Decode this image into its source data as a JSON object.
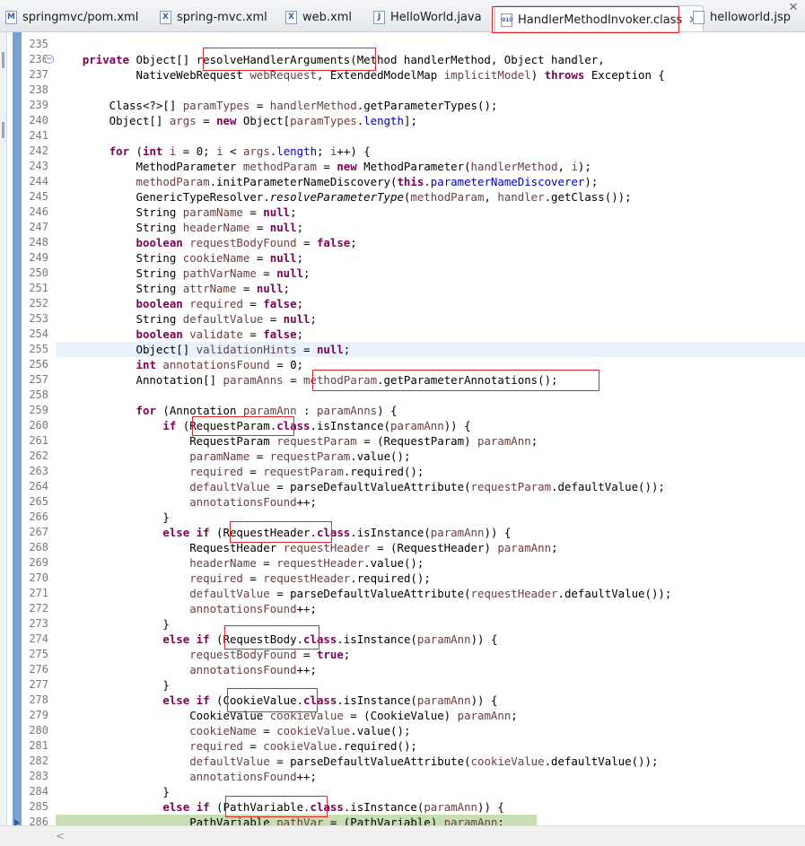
{
  "tabs": [
    {
      "label": "springmvc/pom.xml",
      "icon": "maven-file-icon",
      "glyph": "M",
      "active": false
    },
    {
      "label": "spring-mvc.xml",
      "icon": "xml-file-icon",
      "glyph": "X",
      "active": false
    },
    {
      "label": "web.xml",
      "icon": "xml-file-icon",
      "glyph": "X",
      "active": false
    },
    {
      "label": "HelloWorld.java",
      "icon": "java-file-icon",
      "glyph": "J",
      "active": false
    },
    {
      "label": "HandlerMethodInvoker.class",
      "icon": "class-file-icon",
      "glyph": "010",
      "active": true
    },
    {
      "label": "helloworld.jsp",
      "icon": "jsp-file-icon",
      "glyph": "",
      "active": false
    }
  ],
  "tab_close_glyph": "✕",
  "window_close_glyph": "✕",
  "lines": [
    {
      "n": "235",
      "t": []
    },
    {
      "n": "236",
      "t": [
        [
          "    ",
          ""
        ],
        [
          "private",
          "kw"
        ],
        [
          " Object[] resolveHandlerArguments(Method handlerMethod, Object handler,",
          ""
        ]
      ]
    },
    {
      "n": "237",
      "t": [
        [
          "            NativeWebRequest ",
          ""
        ],
        [
          "webRequest",
          "loc"
        ],
        [
          ", ExtendedModelMap ",
          ""
        ],
        [
          "implicitModel",
          "loc"
        ],
        [
          ") ",
          ""
        ],
        [
          "throws",
          "kw"
        ],
        [
          " Exception {",
          ""
        ]
      ]
    },
    {
      "n": "238",
      "t": []
    },
    {
      "n": "239",
      "t": [
        [
          "        Class<?>[] ",
          ""
        ],
        [
          "paramTypes",
          "loc"
        ],
        [
          " = ",
          ""
        ],
        [
          "handlerMethod",
          "loc"
        ],
        [
          ".getParameterTypes();",
          ""
        ]
      ]
    },
    {
      "n": "240",
      "t": [
        [
          "        Object[] ",
          ""
        ],
        [
          "args",
          "loc"
        ],
        [
          " = ",
          ""
        ],
        [
          "new",
          "kw"
        ],
        [
          " Object[",
          ""
        ],
        [
          "paramTypes",
          "loc"
        ],
        [
          ".",
          ""
        ],
        [
          "length",
          "fld"
        ],
        [
          "];",
          ""
        ]
      ]
    },
    {
      "n": "241",
      "t": []
    },
    {
      "n": "242",
      "t": [
        [
          "        ",
          ""
        ],
        [
          "for",
          "kw"
        ],
        [
          " (",
          ""
        ],
        [
          "int",
          "kw"
        ],
        [
          " ",
          ""
        ],
        [
          "i",
          "loc"
        ],
        [
          " = 0; ",
          ""
        ],
        [
          "i",
          "loc"
        ],
        [
          " < ",
          ""
        ],
        [
          "args",
          "loc"
        ],
        [
          ".",
          ""
        ],
        [
          "length",
          "fld"
        ],
        [
          "; ",
          ""
        ],
        [
          "i",
          "loc"
        ],
        [
          "++) {",
          ""
        ]
      ]
    },
    {
      "n": "243",
      "t": [
        [
          "            MethodParameter ",
          ""
        ],
        [
          "methodParam",
          "loc"
        ],
        [
          " = ",
          ""
        ],
        [
          "new",
          "kw"
        ],
        [
          " MethodParameter(",
          ""
        ],
        [
          "handlerMethod",
          "loc"
        ],
        [
          ", ",
          ""
        ],
        [
          "i",
          "loc"
        ],
        [
          ");",
          ""
        ]
      ]
    },
    {
      "n": "244",
      "t": [
        [
          "            ",
          ""
        ],
        [
          "methodParam",
          "loc"
        ],
        [
          ".initParameterNameDiscovery(",
          ""
        ],
        [
          "this",
          "kw"
        ],
        [
          ".",
          ""
        ],
        [
          "parameterNameDiscoverer",
          "fld"
        ],
        [
          ");",
          ""
        ]
      ]
    },
    {
      "n": "245",
      "t": [
        [
          "            GenericTypeResolver.",
          ""
        ],
        [
          "resolveParameterType",
          "ital"
        ],
        [
          "(",
          ""
        ],
        [
          "methodParam",
          "loc"
        ],
        [
          ", ",
          ""
        ],
        [
          "handler",
          "loc"
        ],
        [
          ".getClass());",
          ""
        ]
      ]
    },
    {
      "n": "246",
      "t": [
        [
          "            String ",
          ""
        ],
        [
          "paramName",
          "loc"
        ],
        [
          " = ",
          ""
        ],
        [
          "null",
          "kw"
        ],
        [
          ";",
          ""
        ]
      ]
    },
    {
      "n": "247",
      "t": [
        [
          "            String ",
          ""
        ],
        [
          "headerName",
          "loc"
        ],
        [
          " = ",
          ""
        ],
        [
          "null",
          "kw"
        ],
        [
          ";",
          ""
        ]
      ]
    },
    {
      "n": "248",
      "t": [
        [
          "            ",
          ""
        ],
        [
          "boolean",
          "kw"
        ],
        [
          " ",
          ""
        ],
        [
          "requestBodyFound",
          "loc"
        ],
        [
          " = ",
          ""
        ],
        [
          "false",
          "kw"
        ],
        [
          ";",
          ""
        ]
      ]
    },
    {
      "n": "249",
      "t": [
        [
          "            String ",
          ""
        ],
        [
          "cookieName",
          "loc"
        ],
        [
          " = ",
          ""
        ],
        [
          "null",
          "kw"
        ],
        [
          ";",
          ""
        ]
      ]
    },
    {
      "n": "250",
      "t": [
        [
          "            String ",
          ""
        ],
        [
          "pathVarName",
          "loc"
        ],
        [
          " = ",
          ""
        ],
        [
          "null",
          "kw"
        ],
        [
          ";",
          ""
        ]
      ]
    },
    {
      "n": "251",
      "t": [
        [
          "            String ",
          ""
        ],
        [
          "attrName",
          "loc"
        ],
        [
          " = ",
          ""
        ],
        [
          "null",
          "kw"
        ],
        [
          ";",
          ""
        ]
      ]
    },
    {
      "n": "252",
      "t": [
        [
          "            ",
          ""
        ],
        [
          "boolean",
          "kw"
        ],
        [
          " ",
          ""
        ],
        [
          "required",
          "loc"
        ],
        [
          " = ",
          ""
        ],
        [
          "false",
          "kw"
        ],
        [
          ";",
          ""
        ]
      ]
    },
    {
      "n": "253",
      "t": [
        [
          "            String ",
          ""
        ],
        [
          "defaultValue",
          "loc"
        ],
        [
          " = ",
          ""
        ],
        [
          "null",
          "kw"
        ],
        [
          ";",
          ""
        ]
      ]
    },
    {
      "n": "254",
      "t": [
        [
          "            ",
          ""
        ],
        [
          "boolean",
          "kw"
        ],
        [
          " ",
          ""
        ],
        [
          "validate",
          "loc"
        ],
        [
          " = ",
          ""
        ],
        [
          "false",
          "kw"
        ],
        [
          ";",
          ""
        ]
      ]
    },
    {
      "n": "255",
      "t": [
        [
          "            Object[] ",
          ""
        ],
        [
          "validationHints",
          "loc"
        ],
        [
          " = ",
          ""
        ],
        [
          "null",
          "kw"
        ],
        [
          ";",
          ""
        ]
      ]
    },
    {
      "n": "256",
      "t": [
        [
          "            ",
          ""
        ],
        [
          "int",
          "kw"
        ],
        [
          " ",
          ""
        ],
        [
          "annotationsFound",
          "loc"
        ],
        [
          " = 0;",
          ""
        ]
      ]
    },
    {
      "n": "257",
      "t": [
        [
          "            Annotation[] ",
          ""
        ],
        [
          "paramAnns",
          "loc"
        ],
        [
          " = ",
          ""
        ],
        [
          "methodParam",
          "loc"
        ],
        [
          ".getParameterAnnotations();",
          ""
        ]
      ]
    },
    {
      "n": "258",
      "t": []
    },
    {
      "n": "259",
      "t": [
        [
          "            ",
          ""
        ],
        [
          "for",
          "kw"
        ],
        [
          " (Annotation ",
          ""
        ],
        [
          "paramAnn",
          "loc"
        ],
        [
          " : ",
          ""
        ],
        [
          "paramAnns",
          "loc"
        ],
        [
          ") {",
          ""
        ]
      ]
    },
    {
      "n": "260",
      "t": [
        [
          "                ",
          ""
        ],
        [
          "if",
          "kw"
        ],
        [
          " (RequestParam.",
          ""
        ],
        [
          "class",
          "kw"
        ],
        [
          ".isInstance(",
          ""
        ],
        [
          "paramAnn",
          "loc"
        ],
        [
          ")) {",
          ""
        ]
      ]
    },
    {
      "n": "261",
      "t": [
        [
          "                    RequestParam ",
          ""
        ],
        [
          "requestParam",
          "loc"
        ],
        [
          " = (RequestParam) ",
          ""
        ],
        [
          "paramAnn",
          "loc"
        ],
        [
          ";",
          ""
        ]
      ]
    },
    {
      "n": "262",
      "t": [
        [
          "                    ",
          ""
        ],
        [
          "paramName",
          "loc"
        ],
        [
          " = ",
          ""
        ],
        [
          "requestParam",
          "loc"
        ],
        [
          ".value();",
          ""
        ]
      ]
    },
    {
      "n": "263",
      "t": [
        [
          "                    ",
          ""
        ],
        [
          "required",
          "loc"
        ],
        [
          " = ",
          ""
        ],
        [
          "requestParam",
          "loc"
        ],
        [
          ".required();",
          ""
        ]
      ]
    },
    {
      "n": "264",
      "t": [
        [
          "                    ",
          ""
        ],
        [
          "defaultValue",
          "loc"
        ],
        [
          " = parseDefaultValueAttribute(",
          ""
        ],
        [
          "requestParam",
          "loc"
        ],
        [
          ".defaultValue());",
          ""
        ]
      ]
    },
    {
      "n": "265",
      "t": [
        [
          "                    ",
          ""
        ],
        [
          "annotationsFound",
          "loc"
        ],
        [
          "++;",
          ""
        ]
      ]
    },
    {
      "n": "266",
      "t": [
        [
          "                }",
          ""
        ]
      ]
    },
    {
      "n": "267",
      "t": [
        [
          "                ",
          ""
        ],
        [
          "else",
          "kw"
        ],
        [
          " ",
          ""
        ],
        [
          "if",
          "kw"
        ],
        [
          " (RequestHeader.",
          ""
        ],
        [
          "class",
          "kw"
        ],
        [
          ".isInstance(",
          ""
        ],
        [
          "paramAnn",
          "loc"
        ],
        [
          ")) {",
          ""
        ]
      ]
    },
    {
      "n": "268",
      "t": [
        [
          "                    RequestHeader ",
          ""
        ],
        [
          "requestHeader",
          "loc"
        ],
        [
          " = (RequestHeader) ",
          ""
        ],
        [
          "paramAnn",
          "loc"
        ],
        [
          ";",
          ""
        ]
      ]
    },
    {
      "n": "269",
      "t": [
        [
          "                    ",
          ""
        ],
        [
          "headerName",
          "loc"
        ],
        [
          " = ",
          ""
        ],
        [
          "requestHeader",
          "loc"
        ],
        [
          ".value();",
          ""
        ]
      ]
    },
    {
      "n": "270",
      "t": [
        [
          "                    ",
          ""
        ],
        [
          "required",
          "loc"
        ],
        [
          " = ",
          ""
        ],
        [
          "requestHeader",
          "loc"
        ],
        [
          ".required();",
          ""
        ]
      ]
    },
    {
      "n": "271",
      "t": [
        [
          "                    ",
          ""
        ],
        [
          "defaultValue",
          "loc"
        ],
        [
          " = parseDefaultValueAttribute(",
          ""
        ],
        [
          "requestHeader",
          "loc"
        ],
        [
          ".defaultValue());",
          ""
        ]
      ]
    },
    {
      "n": "272",
      "t": [
        [
          "                    ",
          ""
        ],
        [
          "annotationsFound",
          "loc"
        ],
        [
          "++;",
          ""
        ]
      ]
    },
    {
      "n": "273",
      "t": [
        [
          "                }",
          ""
        ]
      ]
    },
    {
      "n": "274",
      "t": [
        [
          "                ",
          ""
        ],
        [
          "else",
          "kw"
        ],
        [
          " ",
          ""
        ],
        [
          "if",
          "kw"
        ],
        [
          " (RequestBody.",
          ""
        ],
        [
          "class",
          "kw"
        ],
        [
          ".isInstance(",
          ""
        ],
        [
          "paramAnn",
          "loc"
        ],
        [
          ")) {",
          ""
        ]
      ]
    },
    {
      "n": "275",
      "t": [
        [
          "                    ",
          ""
        ],
        [
          "requestBodyFound",
          "loc"
        ],
        [
          " = ",
          ""
        ],
        [
          "true",
          "kw"
        ],
        [
          ";",
          ""
        ]
      ]
    },
    {
      "n": "276",
      "t": [
        [
          "                    ",
          ""
        ],
        [
          "annotationsFound",
          "loc"
        ],
        [
          "++;",
          ""
        ]
      ]
    },
    {
      "n": "277",
      "t": [
        [
          "                }",
          ""
        ]
      ]
    },
    {
      "n": "278",
      "t": [
        [
          "                ",
          ""
        ],
        [
          "else",
          "kw"
        ],
        [
          " ",
          ""
        ],
        [
          "if",
          "kw"
        ],
        [
          " (CookieValue.",
          ""
        ],
        [
          "class",
          "kw"
        ],
        [
          ".isInstance(",
          ""
        ],
        [
          "paramAnn",
          "loc"
        ],
        [
          ")) {",
          ""
        ]
      ]
    },
    {
      "n": "279",
      "t": [
        [
          "                    CookieValue ",
          ""
        ],
        [
          "cookieValue",
          "loc"
        ],
        [
          " = (CookieValue) ",
          ""
        ],
        [
          "paramAnn",
          "loc"
        ],
        [
          ";",
          ""
        ]
      ]
    },
    {
      "n": "280",
      "t": [
        [
          "                    ",
          ""
        ],
        [
          "cookieName",
          "loc"
        ],
        [
          " = ",
          ""
        ],
        [
          "cookieValue",
          "loc"
        ],
        [
          ".value();",
          ""
        ]
      ]
    },
    {
      "n": "281",
      "t": [
        [
          "                    ",
          ""
        ],
        [
          "required",
          "loc"
        ],
        [
          " = ",
          ""
        ],
        [
          "cookieValue",
          "loc"
        ],
        [
          ".required();",
          ""
        ]
      ]
    },
    {
      "n": "282",
      "t": [
        [
          "                    ",
          ""
        ],
        [
          "defaultValue",
          "loc"
        ],
        [
          " = parseDefaultValueAttribute(",
          ""
        ],
        [
          "cookieValue",
          "loc"
        ],
        [
          ".defaultValue());",
          ""
        ]
      ]
    },
    {
      "n": "283",
      "t": [
        [
          "                    ",
          ""
        ],
        [
          "annotationsFound",
          "loc"
        ],
        [
          "++;",
          ""
        ]
      ]
    },
    {
      "n": "284",
      "t": [
        [
          "                }",
          ""
        ]
      ]
    },
    {
      "n": "285",
      "t": [
        [
          "                ",
          ""
        ],
        [
          "else",
          "kw"
        ],
        [
          " ",
          ""
        ],
        [
          "if",
          "kw"
        ],
        [
          " (PathVariable.",
          ""
        ],
        [
          "class",
          "kw"
        ],
        [
          ".isInstance(",
          ""
        ],
        [
          "paramAnn",
          "loc"
        ],
        [
          ")) {",
          ""
        ]
      ]
    },
    {
      "n": "286",
      "t": [
        [
          "                    PathVariable ",
          ""
        ],
        [
          "pathVar",
          "loc"
        ],
        [
          " = (PathVariable) ",
          ""
        ],
        [
          "paramAnn",
          "loc"
        ],
        [
          ";",
          ""
        ]
      ]
    }
  ],
  "current_line": "255",
  "debug_line": "286",
  "fold_line": "236",
  "highlight_colors": {
    "current_line": "#e8f2fe",
    "debug_line": "#c6deb0",
    "annotation_box": "#e0262b"
  },
  "syntax_colors": {
    "keyword": "#7f0055",
    "field": "#0000c0",
    "local_variable": "#6a3e3e"
  },
  "scroll_left_glyph": "<"
}
